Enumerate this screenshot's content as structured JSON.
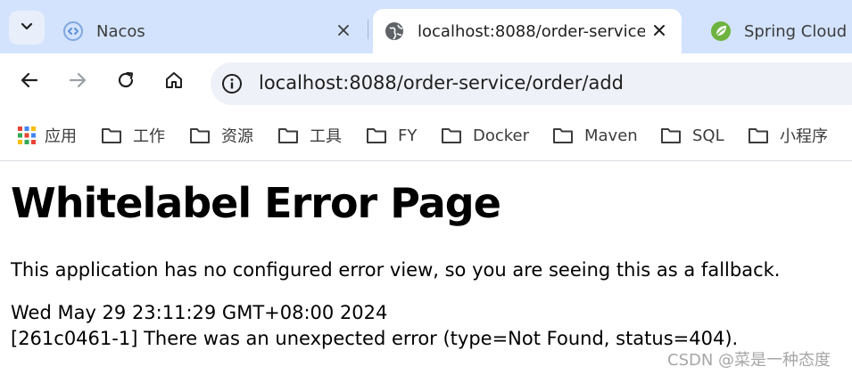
{
  "tabs": [
    {
      "title": "Nacos",
      "close": "×"
    },
    {
      "title": "localhost:8088/order-service/",
      "close": "×"
    },
    {
      "title": "Spring Cloud Gat"
    }
  ],
  "toolbar": {
    "url": "localhost:8088/order-service/order/add"
  },
  "bookmarks": [
    "应用",
    "工作",
    "资源",
    "工具",
    "FY",
    "Docker",
    "Maven",
    "SQL",
    "小程序"
  ],
  "page": {
    "heading": "Whitelabel Error Page",
    "message": "This application has no configured error view, so you are seeing this as a fallback.",
    "timestamp": "Wed May 29 23:11:29 GMT+08:00 2024",
    "error": "[261c0461-1] There was an unexpected error (type=Not Found, status=404)."
  },
  "watermark": "CSDN @菜是一种态度",
  "colors": {
    "tab_strip": "#d3e3fd",
    "omnibox": "#eef1f7",
    "spring_green": "#6db33f",
    "nacos_blue": "#5b8fd6"
  }
}
